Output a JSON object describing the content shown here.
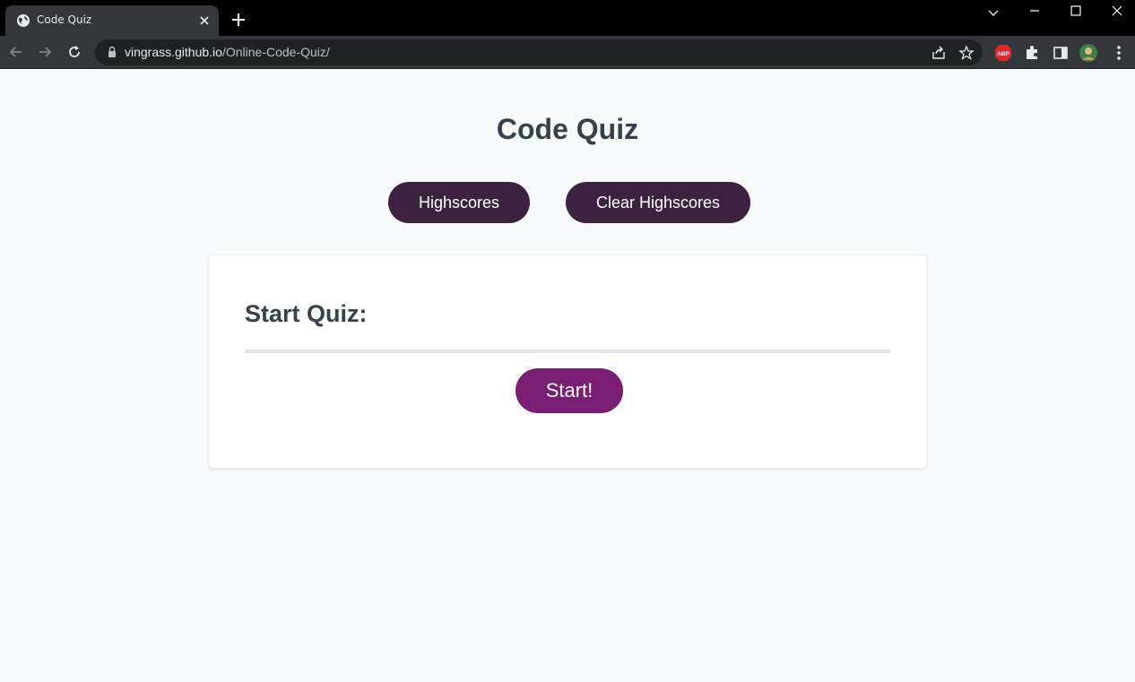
{
  "browser": {
    "tab_title": "Code Quiz",
    "url_host": "vingrass.github.io",
    "url_path": "/Online-Code-Quiz/",
    "extension_badge": "ABP"
  },
  "page": {
    "title": "Code Quiz",
    "highscores_label": "Highscores",
    "clear_highscores_label": "Clear Highscores",
    "card_title": "Start Quiz:",
    "start_label": "Start!"
  },
  "colors": {
    "nav_button_bg": "#3c2240",
    "start_button_bg": "#791e72",
    "heading_text": "#37404b"
  }
}
